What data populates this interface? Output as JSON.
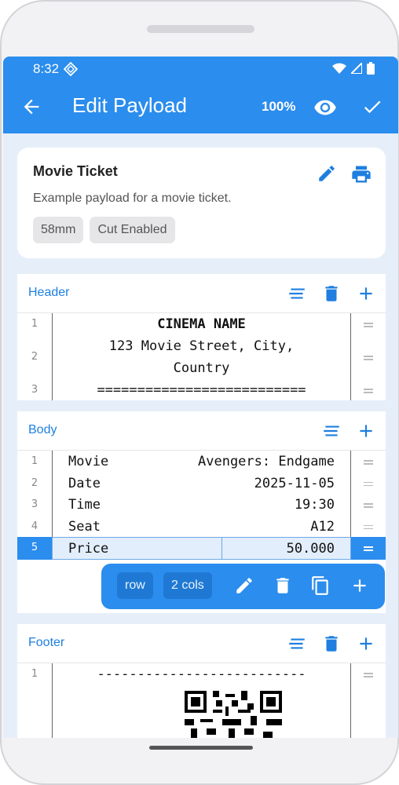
{
  "status_bar": {
    "time": "8:32"
  },
  "app_bar": {
    "title": "Edit Payload",
    "zoom": "100%"
  },
  "payload_card": {
    "title": "Movie Ticket",
    "description": "Example payload for a movie ticket.",
    "chips": [
      "58mm",
      "Cut Enabled"
    ]
  },
  "sections": {
    "header": {
      "label": "Header",
      "lines": [
        {
          "num": "1",
          "text": "CINEMA NAME"
        },
        {
          "num": "2",
          "text": "123 Movie Street, City,",
          "text2": "Country"
        },
        {
          "num": "3",
          "text": "=========================="
        }
      ]
    },
    "body": {
      "label": "Body",
      "rows": [
        {
          "num": "1",
          "left": "Movie",
          "right": "Avengers: Endgame"
        },
        {
          "num": "2",
          "left": "Date",
          "right": "2025-11-05"
        },
        {
          "num": "3",
          "left": "Time",
          "right": "19:30"
        },
        {
          "num": "4",
          "left": "Seat",
          "right": "A12"
        },
        {
          "num": "5",
          "left": "Price",
          "right": "50.000"
        }
      ],
      "selected_row": 5
    },
    "footer": {
      "label": "Footer",
      "lines": [
        {
          "num": "1",
          "text": "--------------------------"
        }
      ]
    }
  },
  "row_toolbar": {
    "type": "row",
    "cols": "2 cols"
  },
  "colors": {
    "primary": "#2b8ded",
    "accent_text": "#1e7fe0",
    "background": "#e6eff9"
  },
  "icons": [
    "back-arrow-icon",
    "eye-icon",
    "check-icon",
    "pencil-icon",
    "printer-icon",
    "align-icon",
    "trash-icon",
    "plus-icon",
    "copy-icon",
    "drag-handle-icon",
    "qr-code-icon"
  ]
}
